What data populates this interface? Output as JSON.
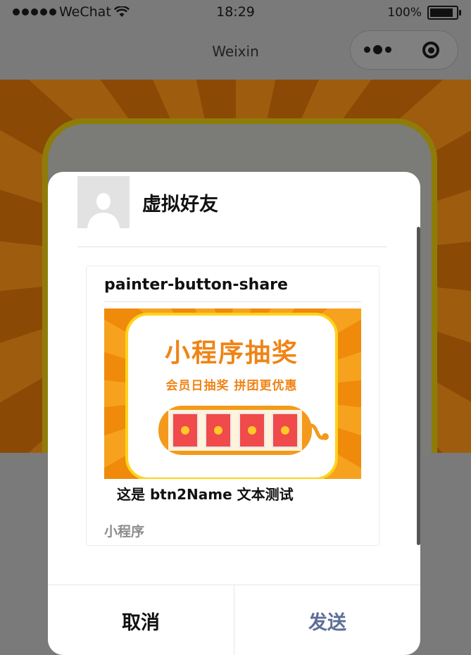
{
  "status_bar": {
    "carrier": "WeChat",
    "time": "18:29",
    "battery": "100%"
  },
  "navbar": {
    "title": "Weixin"
  },
  "share_dialog": {
    "contact_name": "虚拟好友",
    "card": {
      "title": "painter-button-share",
      "preview": {
        "title": "小程序抽奖",
        "subtitle": "会员日抽奖 拼团更优惠"
      },
      "description": "这是 btn2Name 文本测试",
      "footer": "小程序"
    },
    "cancel_label": "取消",
    "send_label": "发送"
  },
  "colors": {
    "overlay": "#7a7a7a",
    "send_text": "#5d6f98",
    "banner_orange": "#f08f10",
    "lottery_text": "#ef8416"
  }
}
